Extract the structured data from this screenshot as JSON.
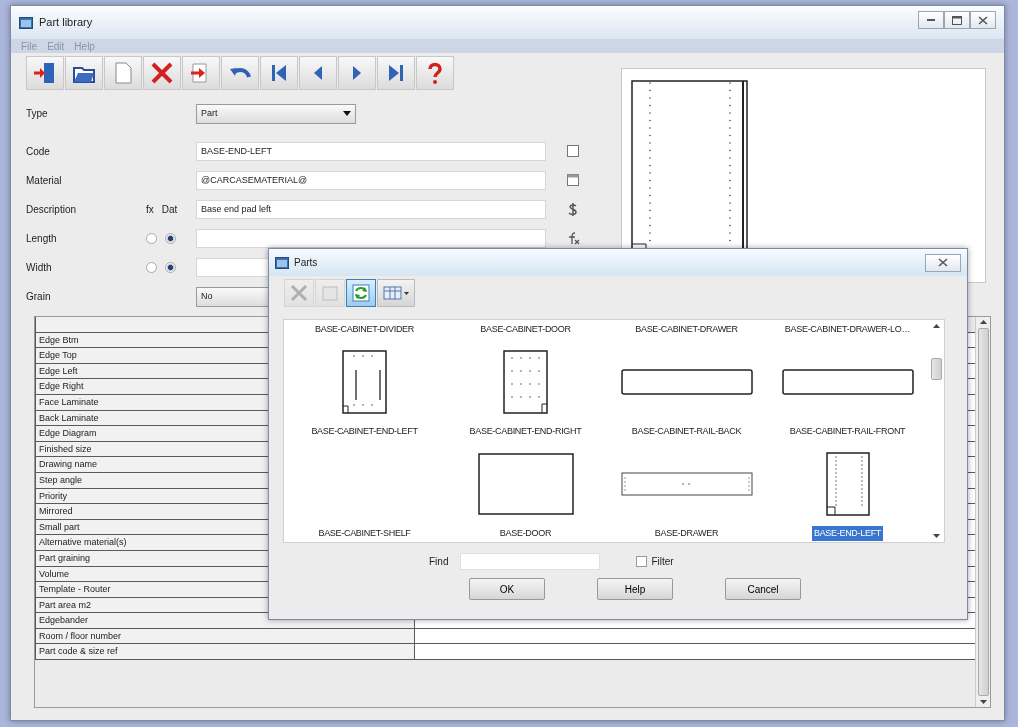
{
  "window": {
    "title": "Part library"
  },
  "menu": [
    "File",
    "Edit",
    "Help"
  ],
  "form": {
    "source_headers": [
      "fx",
      "Dat"
    ],
    "rows": [
      {
        "kind": "select",
        "label": "Type",
        "value": "Part"
      },
      {
        "kind": "text",
        "label": "Code",
        "value": "BASE-END-LEFT"
      },
      {
        "kind": "text",
        "label": "Material",
        "value": "@CARCASEMATERIAL@"
      },
      {
        "kind": "text",
        "label": "Description",
        "value": "Base end pad left"
      },
      {
        "kind": "formula",
        "label": "Length",
        "fx": false,
        "dat": true
      },
      {
        "kind": "formula",
        "label": "Width",
        "fx": false,
        "dat": true
      },
      {
        "kind": "select",
        "label": "Grain",
        "value": "No"
      }
    ]
  },
  "properties": [
    "Edge Btm",
    "Edge Top",
    "Edge Left",
    "Edge Right",
    "Face Laminate",
    "Back Laminate",
    "Edge Diagram",
    "Finished size",
    "Drawing name",
    "Step angle",
    "Priority",
    "Mirrored",
    "Small part",
    "Alternative material(s)",
    "Part graining",
    "Volume",
    "Template - Router",
    "Part area m2",
    "Edgebander",
    "Room / floor number",
    "Part code & size ref"
  ],
  "parts_dialog": {
    "title": "Parts",
    "toolbar": [
      {
        "disabled": true,
        "selected": false
      },
      {
        "disabled": true,
        "selected": false
      },
      {
        "disabled": false,
        "selected": true
      },
      {
        "disabled": false,
        "selected": false
      }
    ],
    "items": [
      {
        "label": "BASE-CABINET-DIVIDER",
        "selected": false,
        "kind": "plain"
      },
      {
        "label": "BASE-CABINET-DOOR",
        "selected": false,
        "kind": "plain"
      },
      {
        "label": "BASE-CABINET-DRAWER",
        "selected": false,
        "kind": "plain"
      },
      {
        "label": "BASE-CABINET-DRAWER-LO…",
        "selected": false,
        "kind": "plain"
      },
      {
        "label": "BASE-CABINET-END-LEFT",
        "selected": false,
        "kind": "divider"
      },
      {
        "label": "BASE-CABINET-END-RIGHT",
        "selected": false,
        "kind": "dotted"
      },
      {
        "label": "BASE-CABINET-RAIL-BACK",
        "selected": false,
        "kind": "wide"
      },
      {
        "label": "BASE-CABINET-RAIL-FRONT",
        "selected": false,
        "kind": "wide"
      },
      {
        "label": "BASE-CABINET-SHELF",
        "selected": false,
        "kind": "blank"
      },
      {
        "label": "BASE-DOOR",
        "selected": false,
        "kind": "square"
      },
      {
        "label": "BASE-DRAWER",
        "selected": false,
        "kind": "rail"
      },
      {
        "label": "BASE-END-LEFT",
        "selected": true,
        "kind": "end"
      }
    ],
    "find_label": "Find",
    "filter": {
      "label": "Filter",
      "checked": false
    },
    "buttons": [
      "OK",
      "Help",
      "Cancel"
    ]
  }
}
